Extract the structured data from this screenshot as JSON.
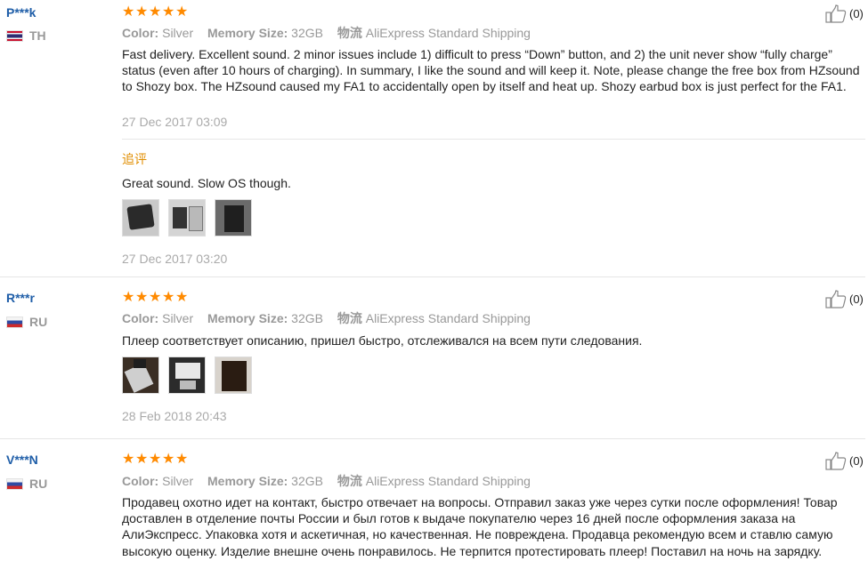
{
  "reviews": [
    {
      "user": "P***k",
      "country": "TH",
      "flag": "th",
      "rating": 5,
      "color_label": "Color:",
      "color_value": "Silver",
      "memory_label": "Memory Size:",
      "memory_value": "32GB",
      "logistics_label": "物流",
      "logistics_value": "AliExpress Standard Shipping",
      "likes": "(0)",
      "text": "Fast delivery. Excellent sound. 2 minor issues include 1) difficult to press “Down” button, and 2) the unit never show “fully charge” status (even after 10 hours of charging). In summary, I like the sound and will keep it. Note, please change the free box from HZsound to Shozy box. The HZsound caused my FA1 to accidentally open by itself and heat up. Shozy earbud box is just perfect for the FA1.",
      "date": "27 Dec 2017 03:09",
      "followup_label": "追评",
      "followup_text": "Great sound. Slow OS though.",
      "followup_date": "27 Dec 2017 03:20"
    },
    {
      "user": "R***r",
      "country": "RU",
      "flag": "ru",
      "rating": 5,
      "color_label": "Color:",
      "color_value": "Silver",
      "memory_label": "Memory Size:",
      "memory_value": "32GB",
      "logistics_label": "物流",
      "logistics_value": "AliExpress Standard Shipping",
      "likes": "(0)",
      "text": "Плеер соответствует описанию, пришел быстро, отслеживался на всем пути следования.",
      "date": "28 Feb 2018 20:43"
    },
    {
      "user": "V***N",
      "country": "RU",
      "flag": "ru",
      "rating": 5,
      "color_label": "Color:",
      "color_value": "Silver",
      "memory_label": "Memory Size:",
      "memory_value": "32GB",
      "logistics_label": "物流",
      "logistics_value": "AliExpress Standard Shipping",
      "likes": "(0)",
      "text": "Продавец охотно идет на контакт, быстро отвечает на вопросы. Отправил заказ уже через сутки после оформления! Товар доставлен в отделение почты России и был готов к выдаче покупателю через 16 дней после оформления заказа на АлиЭкспресс. Упаковка хотя и аскетичная, но качественная. Не повреждена. Продавца рекомендую всем и ставлю самую высокую оценку. Изделие внешне очень понравилось. Не терпится протестировать плеер! Поставил на ночь на зарядку."
    }
  ],
  "colors": {
    "star": "#ff8a00",
    "username": "#1f5ea8",
    "followup": "#e08e00",
    "meta": "#999999"
  }
}
